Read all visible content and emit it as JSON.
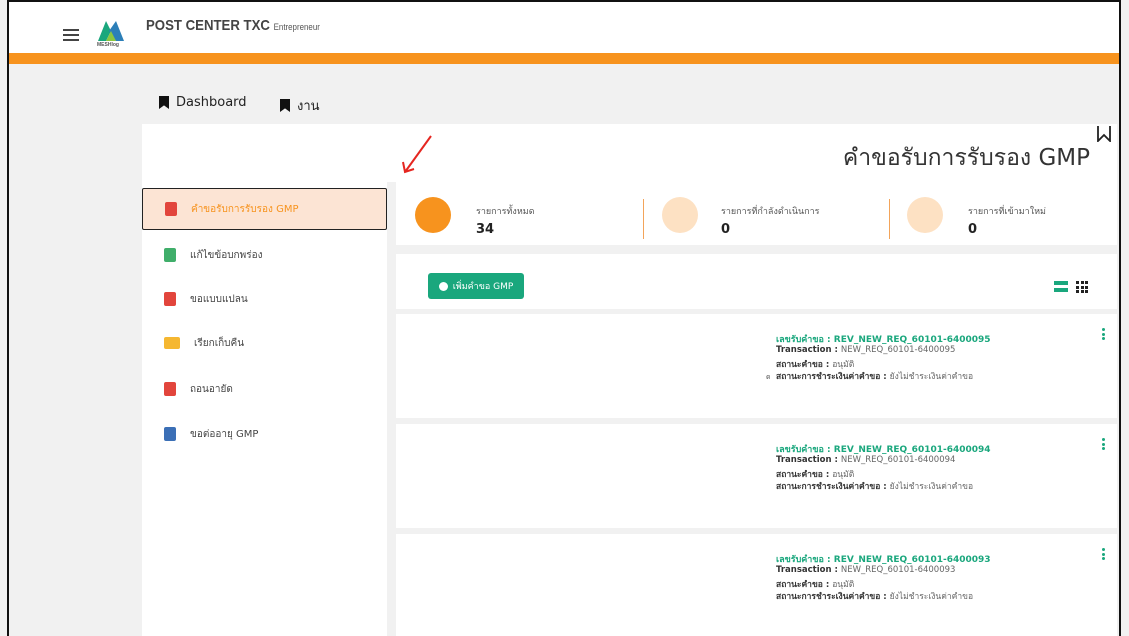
{
  "app": {
    "title": "POST CENTER TXC",
    "subtitle": "Entrepreneur",
    "logo_text": "MESHlog"
  },
  "nav": {
    "tabs": [
      {
        "label": "Dashboard"
      },
      {
        "label": "งาน"
      }
    ]
  },
  "page": {
    "title": "คำขอรับการรับรอง GMP"
  },
  "sidebar": {
    "items": [
      {
        "label": "คำขอรับการรับรอง GMP",
        "icon": "document-red-icon",
        "active": true
      },
      {
        "label": "แก้ไขข้อบกพร่อง",
        "icon": "document-green-icon"
      },
      {
        "label": "ขอแบบแปลน",
        "icon": "document-red-icon"
      },
      {
        "label": "เรียกเก็บคืน",
        "icon": "folder-icon"
      },
      {
        "label": "ถอนอายัด",
        "icon": "document-red-icon"
      },
      {
        "label": "ขอต่ออายุ GMP",
        "icon": "document-blue-icon"
      }
    ]
  },
  "stats": [
    {
      "label": "รายการทั้งหมด",
      "value": "34"
    },
    {
      "label": "รายการที่กำลังดำเนินการ",
      "value": "0"
    },
    {
      "label": "รายการที่เข้ามาใหม่",
      "value": "0"
    }
  ],
  "toolbar": {
    "add_label": "เพิ่มคำขอ GMP"
  },
  "cards": [
    {
      "request_label": "เลขรับคำขอ : ",
      "request_no": "REV_NEW_REQ_60101-6400095",
      "transaction_label": "Transaction : ",
      "transaction": "NEW_REQ_60101-6400095",
      "status_label": "สถานะคำขอ : ",
      "status": "อนุมัติ",
      "payment_label": "สถานะการชำระเงินค่าคำขอ : ",
      "payment": "ยังไม่ชำระเงินค่าคำขอ"
    },
    {
      "request_label": "เลขรับคำขอ : ",
      "request_no": "REV_NEW_REQ_60101-6400094",
      "transaction_label": "Transaction : ",
      "transaction": "NEW_REQ_60101-6400094",
      "status_label": "สถานะคำขอ : ",
      "status": "อนุมัติ",
      "payment_label": "สถานะการชำระเงินค่าคำขอ : ",
      "payment": "ยังไม่ชำระเงินค่าคำขอ"
    },
    {
      "request_label": "เลขรับคำขอ : ",
      "request_no": "REV_NEW_REQ_60101-6400093",
      "transaction_label": "Transaction : ",
      "transaction": "NEW_REQ_60101-6400093",
      "status_label": "สถานะคำขอ : ",
      "status": "อนุมัติ",
      "payment_label": "สถานะการชำระเงินค่าคำขอ : ",
      "payment": "ยังไม่ชำระเงินค่าคำขอ"
    }
  ],
  "stray_text": "ด",
  "colors": {
    "accent_orange": "#f7931e",
    "accent_green": "#1aa77d",
    "active_bg": "#fce4d4"
  }
}
